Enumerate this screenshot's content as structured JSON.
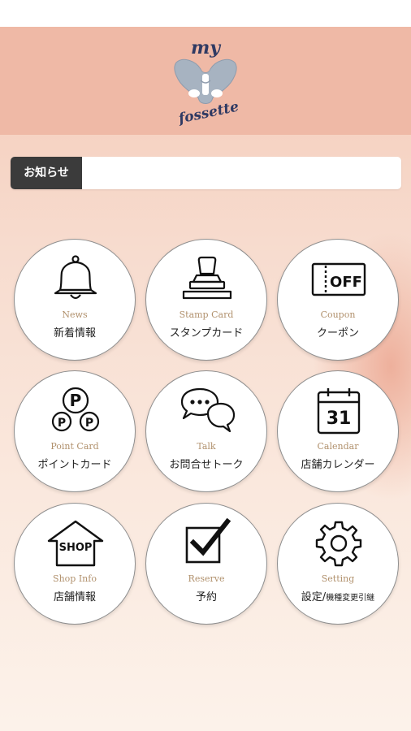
{
  "header": {
    "logo_top": "my",
    "logo_bottom": "fossette"
  },
  "news_bar": {
    "label": "お知らせ",
    "text": ""
  },
  "menu": [
    {
      "en": "News",
      "jp": "新着情報",
      "icon": "bell-icon"
    },
    {
      "en": "Stamp Card",
      "jp": "スタンプカード",
      "icon": "stamp-icon"
    },
    {
      "en": "Coupon",
      "jp": "クーポン",
      "icon": "coupon-off-icon",
      "icon_text": "OFF"
    },
    {
      "en": "Point Card",
      "jp": "ポイントカード",
      "icon": "point-coins-icon",
      "icon_text": "P"
    },
    {
      "en": "Talk",
      "jp": "お問合せトーク",
      "icon": "chat-bubbles-icon"
    },
    {
      "en": "Calendar",
      "jp": "店舗カレンダー",
      "icon": "calendar-icon",
      "icon_text": "31"
    },
    {
      "en": "Shop Info",
      "jp": "店舗情報",
      "icon": "shop-house-icon",
      "icon_text": "SHOP"
    },
    {
      "en": "Reserve",
      "jp": "予約",
      "icon": "checkbox-icon"
    },
    {
      "en": "Setting",
      "jp": "設定/",
      "jp_small": "機種変更引継",
      "icon": "gear-icon"
    }
  ],
  "colors": {
    "header_bg": "#efb9a6",
    "english_label": "#b1916d",
    "news_label_bg": "#3b3b3b",
    "logo_navy": "#2f3a63"
  }
}
